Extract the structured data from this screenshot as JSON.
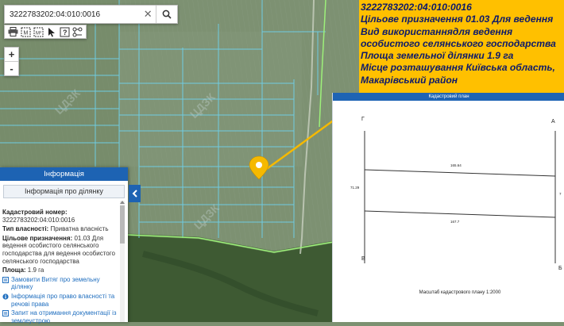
{
  "search": {
    "value": "3222783202:04:010:0016",
    "clear_icon": "close-icon",
    "search_icon": "search-icon"
  },
  "toolbar": {
    "tools": [
      "print-icon",
      "measure-length-icon",
      "measure-area-icon",
      "pointer-icon",
      "identify-icon",
      "layers-icon"
    ]
  },
  "zoom": {
    "in_label": "+",
    "out_label": "-"
  },
  "overlay_text": {
    "line1": "3222783202:04:010:0016",
    "line2": "Цільове призначення   01.03 Для ведення",
    "line3": "Вид використаннядля ведення",
    "line4": "особистого селянського господарства",
    "line5": "Площа земельної ділянки 1.9 га",
    "line6": "Місце розташування  Київська область,",
    "line7": "Макарівський район"
  },
  "plan": {
    "title": "Кадастровий план",
    "corners": {
      "g": "Г",
      "a": "А",
      "v": "В",
      "b": "Б"
    },
    "dims": {
      "top": "165.64",
      "bottom": "167.7",
      "left": "71.29",
      "right": "7"
    },
    "scale": "Масштаб кадастрового плану 1:2000"
  },
  "info": {
    "header": "Інформація",
    "subheader": "Інформація про ділянку",
    "cadastral_label": "Кадастровий номер:",
    "cadastral_value": "3222783202:04:010:0016",
    "ownership_label": "Тип власності:",
    "ownership_value": " Приватна власність",
    "purpose_label": "Цільове призначення:",
    "purpose_value": " 01.03 Для ведення особистого селянського господарства для ведення особистого селянського господарства",
    "area_label": "Площа:",
    "area_value": " 1.9 га",
    "link1": "Замовити Витяг про земельну ділянку",
    "link2": "Інформація про право власності та речові права",
    "link3": "Запит на отримання документації із землеустрою"
  },
  "colors": {
    "panel_blue": "#1d63b3",
    "overlay_yellow": "#ffc000",
    "overlay_text": "#0d1a6b",
    "parcel_line": "#6ed3ee",
    "boundary": "#9df07a",
    "marker": "#f5b900"
  }
}
